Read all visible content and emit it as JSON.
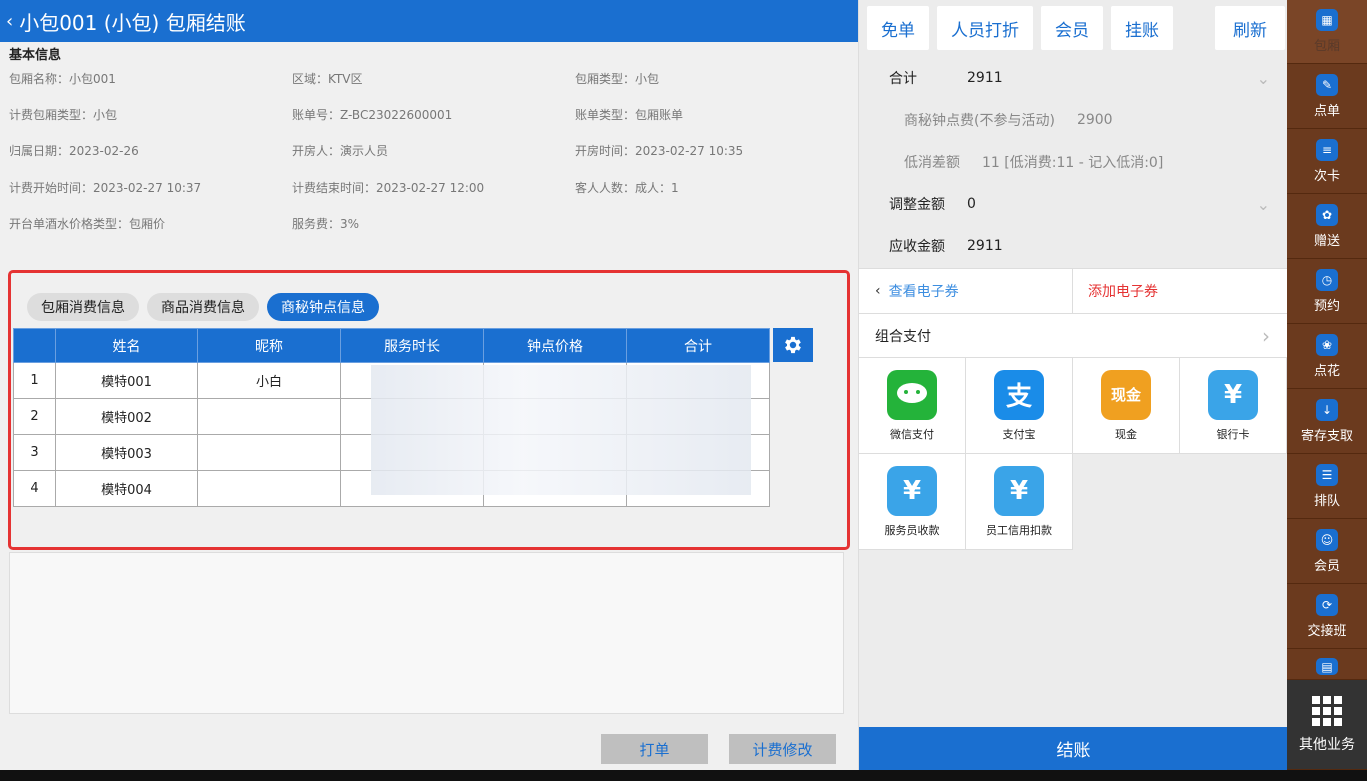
{
  "header": {
    "back": "‹",
    "title": "小包001 (小包) 包厢结账"
  },
  "basic_info": {
    "section_title": "基本信息",
    "fields": [
      [
        "包厢名称：",
        "小包001"
      ],
      [
        "区域：",
        "KTV区"
      ],
      [
        "包厢类型：",
        "小包"
      ],
      [
        "计费包厢类型：",
        "小包"
      ],
      [
        "账单号：",
        "Z-BC23022600001"
      ],
      [
        "账单类型：",
        "包厢账单"
      ],
      [
        "归属日期：",
        "2023-02-26"
      ],
      [
        "开房人：",
        "演示人员"
      ],
      [
        "开房时间：",
        "2023-02-27 10:35"
      ],
      [
        "计费开始时间：",
        "2023-02-27 10:37"
      ],
      [
        "计费结束时间：",
        "2023-02-27 12:00"
      ],
      [
        "客人人数：",
        "成人：1"
      ],
      [
        "开台单酒水价格类型：",
        "包厢价"
      ],
      [
        "服务费：",
        "3%"
      ]
    ]
  },
  "tabs": [
    "包厢消费信息",
    "商品消费信息",
    "商秘钟点信息"
  ],
  "table": {
    "headers": [
      "",
      "姓名",
      "昵称",
      "服务时长",
      "钟点价格",
      "合计"
    ],
    "rows": [
      [
        "1",
        "模特001",
        "小白",
        "",
        "",
        ""
      ],
      [
        "2",
        "模特002",
        "",
        "",
        "",
        ""
      ],
      [
        "3",
        "模特003",
        "",
        "",
        "",
        ""
      ],
      [
        "4",
        "模特004",
        "",
        "",
        "",
        ""
      ]
    ]
  },
  "bottom_buttons": {
    "print": "打单",
    "modify": "计费修改"
  },
  "topbar": {
    "free": "免单",
    "staff_discount": "人员打折",
    "member": "会员",
    "credit": "挂账",
    "refresh": "刷新"
  },
  "summary": {
    "total_label": "合计",
    "total_value": "2911",
    "sec_fee_label": "商秘钟点费(不参与活动)",
    "sec_fee_value": "2900",
    "min_diff_label": "低消差额",
    "min_diff_value": "11 [低消费:11 - 记入低消:0]",
    "adjust_label": "调整金额",
    "adjust_value": "0",
    "receivable_label": "应收金额",
    "receivable_value": "2911"
  },
  "coupon": {
    "view": "查看电子券",
    "add": "添加电子券"
  },
  "combo_pay": "组合支付",
  "payments": [
    {
      "label": "微信支付",
      "icon": "wechat-pay-icon",
      "color": "#24b33a",
      "glyph": "✓"
    },
    {
      "label": "支付宝",
      "icon": "alipay-icon",
      "color": "#1a8ce8",
      "glyph": "支"
    },
    {
      "label": "现金",
      "icon": "cash-icon",
      "color": "#f0a020",
      "glyph": "现金"
    },
    {
      "label": "银行卡",
      "icon": "bank-card-icon",
      "color": "#3aa4e8",
      "glyph": "¥"
    },
    {
      "label": "服务员收款",
      "icon": "waiter-collect-icon",
      "color": "#3aa4e8",
      "glyph": "¥"
    },
    {
      "label": "员工信用扣款",
      "icon": "staff-credit-icon",
      "color": "#3aa4e8",
      "glyph": "¥"
    }
  ],
  "checkout": "结账",
  "sidebar": [
    {
      "label": "包厢",
      "icon": "room-icon",
      "active": true
    },
    {
      "label": "点单",
      "icon": "order-icon"
    },
    {
      "label": "次卡",
      "icon": "times-card-icon"
    },
    {
      "label": "赠送",
      "icon": "gift-icon"
    },
    {
      "label": "预约",
      "icon": "reserve-icon"
    },
    {
      "label": "点花",
      "icon": "flower-icon"
    },
    {
      "label": "寄存支取",
      "icon": "storage-icon"
    },
    {
      "label": "排队",
      "icon": "queue-icon"
    },
    {
      "label": "会员",
      "icon": "member-icon"
    },
    {
      "label": "交接班",
      "icon": "shift-icon"
    },
    {
      "label": "",
      "icon": "report-icon"
    },
    {
      "label": "其他业务",
      "icon": "grid-icon"
    }
  ],
  "colors": {
    "primary": "#1a6fd0",
    "sidebar_bg": "#6b3a1e",
    "highlight_border": "#e53333"
  }
}
